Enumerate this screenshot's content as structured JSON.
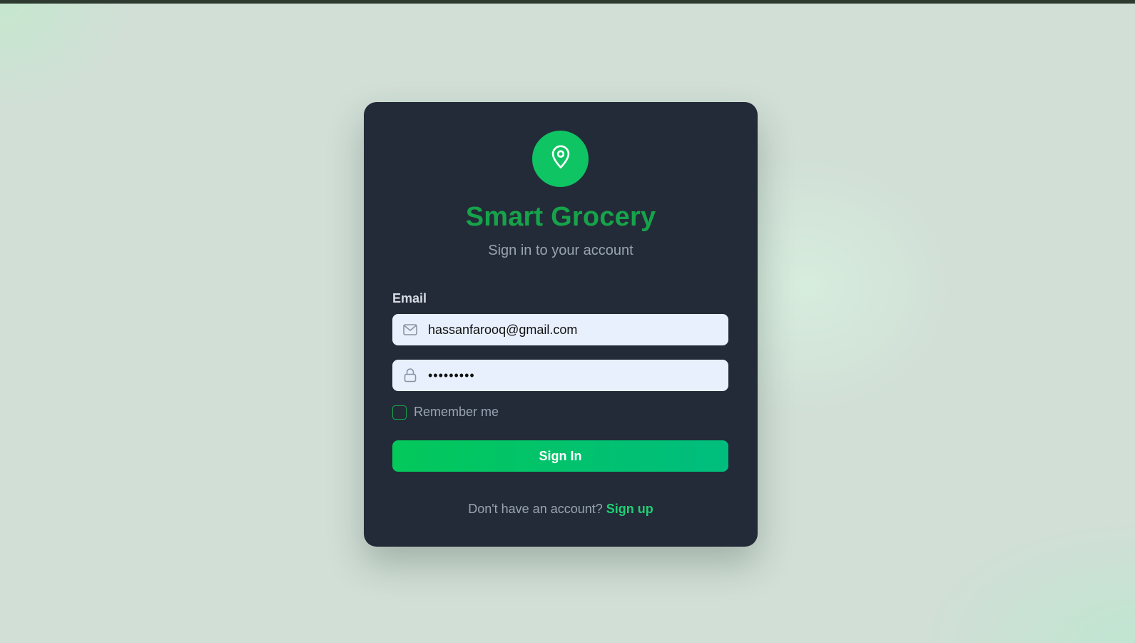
{
  "app": {
    "title": "Smart Grocery",
    "subtitle": "Sign in to your account",
    "logo_icon": "map-pin-icon"
  },
  "form": {
    "email_label": "Email",
    "email_value": "hassanfarooq@gmail.com",
    "email_icon": "mail-icon",
    "password_value": "•••••••••",
    "password_icon": "lock-icon",
    "remember_label": "Remember me",
    "remember_checked": false,
    "submit_label": "Sign In"
  },
  "footer": {
    "prompt": "Don't have an account?",
    "link": "Sign up"
  },
  "colors": {
    "accent": "#16a34a",
    "button_start": "#03c85a",
    "button_end": "#00bd7e",
    "card_bg": "#232b38",
    "field_bg": "#e8f0fe",
    "page_bg": "#d1dfd6"
  }
}
